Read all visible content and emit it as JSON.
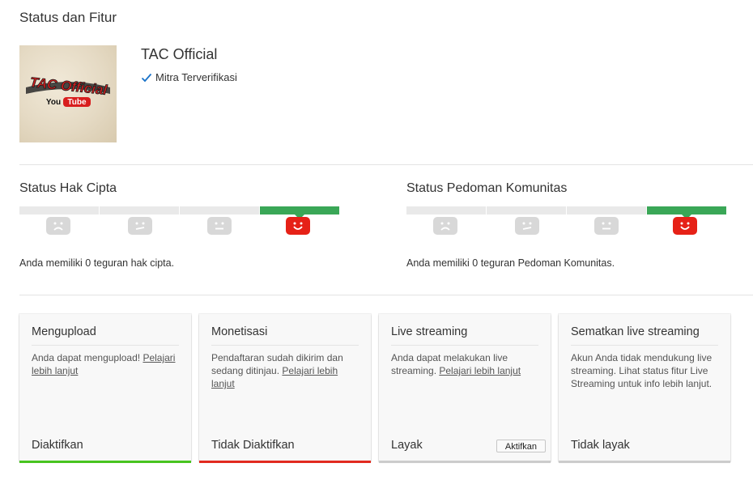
{
  "page": {
    "title": "Status dan Fitur"
  },
  "channel": {
    "name": "TAC Official",
    "verified_label": "Mitra Terverifikasi",
    "logo_text": "TAC Official",
    "logo_sub_left": "You",
    "logo_sub_right": "Tube"
  },
  "copyright": {
    "title": "Status Hak Cipta",
    "text": "Anda memiliki 0 teguran hak cipta.",
    "active_level": 4
  },
  "community": {
    "title": "Status Pedoman Komunitas",
    "text": "Anda memiliki 0 teguran Pedoman Komunitas.",
    "active_level": 4
  },
  "cards": [
    {
      "title": "Mengupload",
      "desc": "Anda dapat mengupload! ",
      "link": "Pelajari lebih lanjut",
      "status": "Diaktifkan",
      "bar_color": "#47c41f"
    },
    {
      "title": "Monetisasi",
      "desc": "Pendaftaran sudah dikirim dan sedang ditinjau. ",
      "link": "Pelajari lebih lanjut",
      "status": "Tidak Diaktifkan",
      "bar_color": "#e12a1f"
    },
    {
      "title": "Live streaming",
      "desc": "Anda dapat melakukan live streaming. ",
      "link": "Pelajari lebih lanjut",
      "status": "Layak",
      "button": "Aktifkan",
      "bar_color": "#cccccc"
    },
    {
      "title": "Sematkan live streaming",
      "desc": "Akun Anda tidak mendukung live streaming. Lihat status fitur Live Streaming untuk info lebih lanjut.",
      "link": "",
      "status": "Tidak layak",
      "bar_color": "#cccccc"
    }
  ],
  "colors": {
    "active_meter": "#3aa757",
    "active_face": "#e62117",
    "inactive_face": "#d8d8d8"
  },
  "icons": {
    "verified": "checkmark-icon",
    "strike_faces": [
      "sad-face-icon",
      "skeptical-face-icon",
      "neutral-face-icon",
      "happy-face-icon"
    ]
  }
}
